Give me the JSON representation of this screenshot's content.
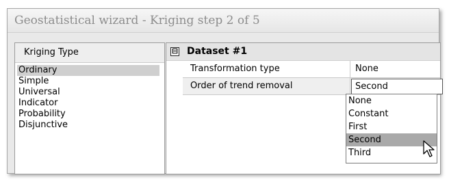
{
  "window": {
    "title": "Geostatistical wizard - Kriging step 2 of 5"
  },
  "kriging_type": {
    "header": "Kriging Type",
    "items": [
      "Ordinary",
      "Simple",
      "Universal",
      "Indicator",
      "Probability",
      "Disjunctive"
    ],
    "selected": "Ordinary"
  },
  "properties": {
    "group_toggle": "⊟",
    "group_title": "Dataset #1",
    "rows": [
      {
        "name": "Transformation type",
        "value": "None"
      },
      {
        "name": "Order of trend removal",
        "value": "Second"
      }
    ]
  },
  "trend_dropdown": {
    "options": [
      "None",
      "Constant",
      "First",
      "Second",
      "Third"
    ],
    "highlighted": "Second"
  },
  "icons": {
    "cursor": "mouse-pointer-icon"
  }
}
